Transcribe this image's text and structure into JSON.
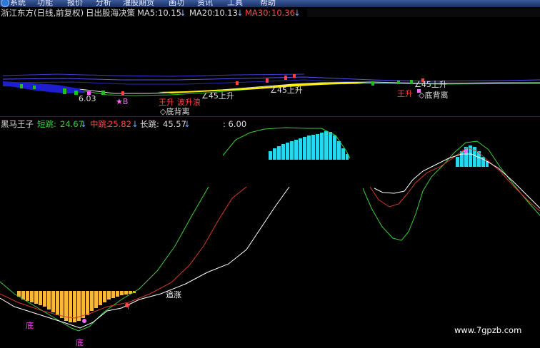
{
  "menu": [
    "系统",
    "功能",
    "报价",
    "分析",
    "灌股期货",
    "画功",
    "资讯",
    "工具",
    "帮助"
  ],
  "top_header": {
    "title": "浙江东方(日线,前复权)",
    "indicator": "日出股海决策",
    "ma5_label": "MA5:",
    "ma5_value": "10.15",
    "ma20_label": "MA20:",
    "ma20_value": "10.13",
    "ma30_label": "MA30:",
    "ma30_value": "10.36",
    "arrow": "↓"
  },
  "top_annotations": {
    "low_price": "6.03",
    "b_mark": "★B",
    "rise1": "王升",
    "ascend": "波升浪",
    "angle1": "∠45上升",
    "angle2": "∠45上升",
    "angle3": "∠45上升",
    "divergence1": "◇底背离",
    "rise2": "王升",
    "divergence2": "◇底背离"
  },
  "sub_header": {
    "name": "黑马王子",
    "short_label": "短跳:",
    "short_value": "24.67",
    "mid_label": "中跳:",
    "mid_value": "25.82",
    "long_label": "长跳:",
    "long_value": "45.57",
    "extra": ": 6.00",
    "arrow": "↓"
  },
  "sub_annotations": {
    "chase": "追涨",
    "bottom1": "底",
    "bottom2": "底",
    "up_arrow": "↑"
  },
  "watermark": "www.7gpzb.com",
  "colors": {
    "short_line": "#ffffff",
    "mid_line": "#d23a2a",
    "long_line": "#3ccf3c",
    "orange_bars": "#f5b937",
    "cyan_bars": "#29d7ef",
    "ma30": "#ff4b4b",
    "ma20": "#ffffff",
    "ma5": "#ffffff"
  }
}
